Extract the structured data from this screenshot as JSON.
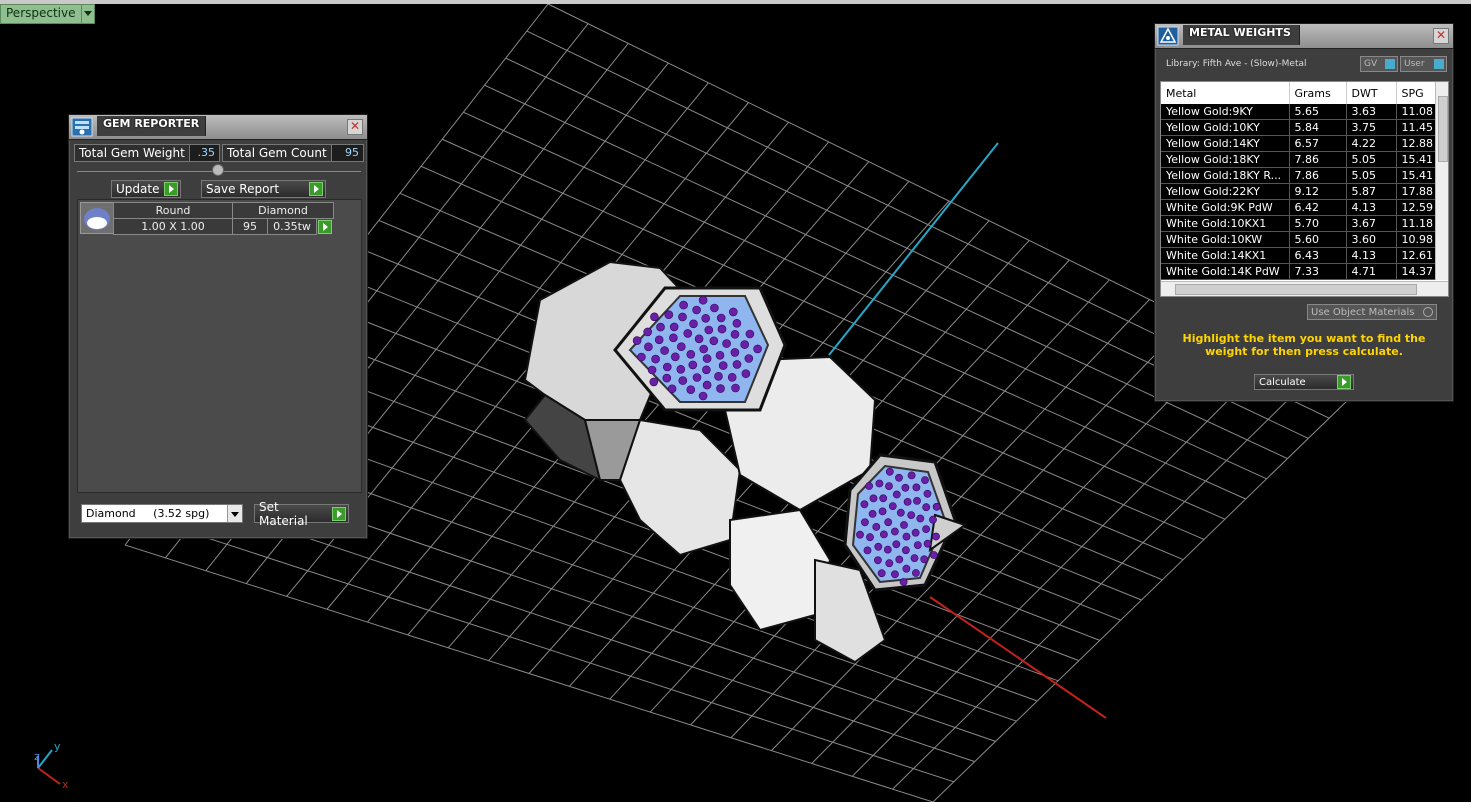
{
  "viewport": {
    "label": "Perspective"
  },
  "axes": {
    "x": "x",
    "y": "y",
    "z": "z"
  },
  "gem_reporter": {
    "title": "GEM REPORTER",
    "total_weight_label": "Total Gem Weight",
    "total_weight_value": ".35",
    "total_count_label": "Total Gem Count",
    "total_count_value": "95",
    "update_label": "Update",
    "save_label": "Save Report",
    "gem": {
      "shape": "Round",
      "material": "Diamond",
      "size": "1.00 X 1.00",
      "count": "95",
      "weight": "0.35tw"
    },
    "material_select": "Diamond     (3.52 spg)",
    "set_material_label": "Set Material"
  },
  "metal_weights": {
    "title": "METAL WEIGHTS",
    "library": "Library: Fifth Ave - (Slow)-Metal",
    "gv_label": "GV",
    "user_label": "User",
    "columns": [
      "Metal",
      "Grams",
      "DWT",
      "SPG"
    ],
    "rows": [
      [
        "Yellow Gold:9KY",
        "5.65",
        "3.63",
        "11.08"
      ],
      [
        "Yellow Gold:10KY",
        "5.84",
        "3.75",
        "11.45"
      ],
      [
        "Yellow Gold:14KY",
        "6.57",
        "4.22",
        "12.88"
      ],
      [
        "Yellow Gold:18KY",
        "7.86",
        "5.05",
        "15.41"
      ],
      [
        "Yellow Gold:18KY R...",
        "7.86",
        "5.05",
        "15.41"
      ],
      [
        "Yellow Gold:22KY",
        "9.12",
        "5.87",
        "17.88"
      ],
      [
        "White Gold:9K PdW",
        "6.42",
        "4.13",
        "12.59"
      ],
      [
        "White Gold:10KX1",
        "5.70",
        "3.67",
        "11.18"
      ],
      [
        "White Gold:10KW",
        "5.60",
        "3.60",
        "10.98"
      ],
      [
        "White Gold:14KX1",
        "6.43",
        "4.13",
        "12.61"
      ],
      [
        "White Gold:14K PdW",
        "7.33",
        "4.71",
        "14.37"
      ]
    ],
    "use_object_materials": "Use Object Materials",
    "message": "Highlight the item you want to find the weight for then press calculate.",
    "calculate_label": "Calculate"
  }
}
